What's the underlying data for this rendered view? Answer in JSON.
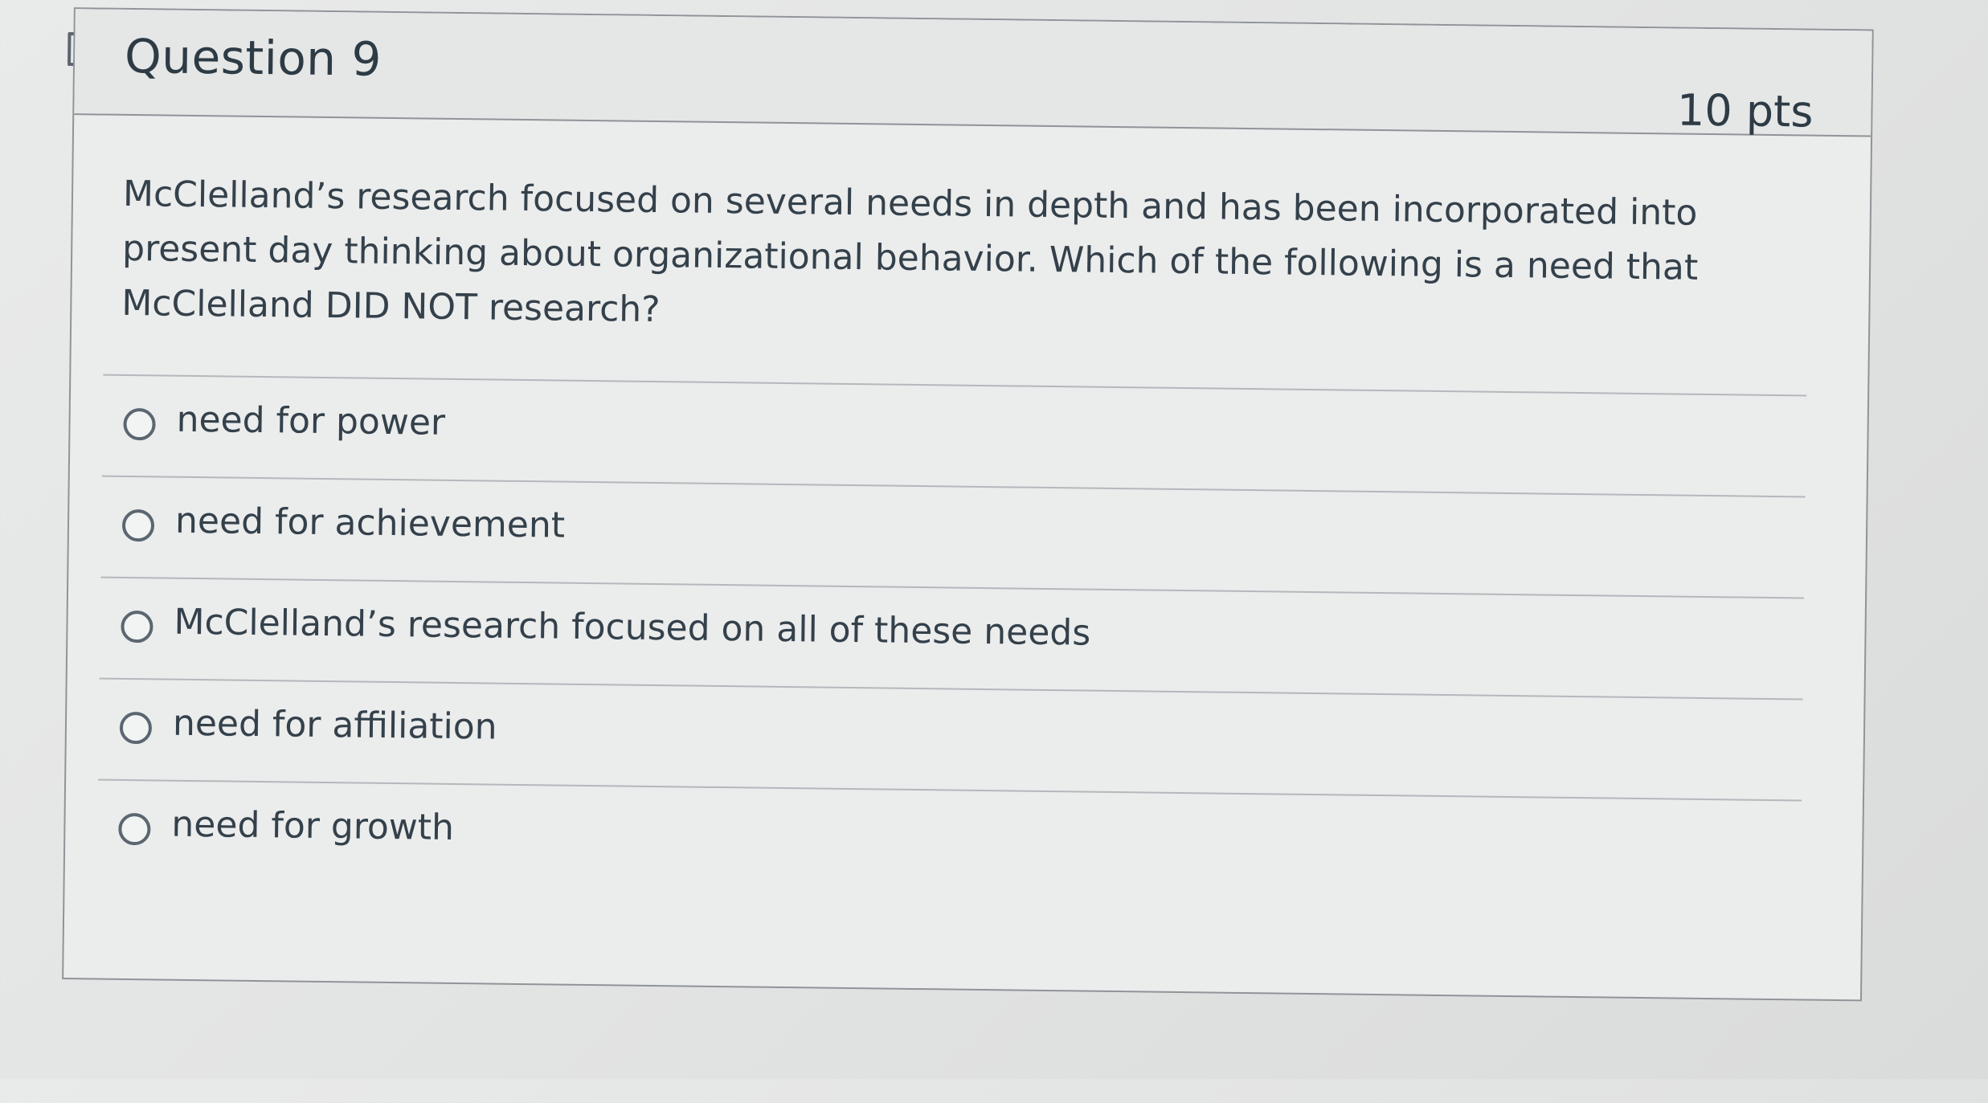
{
  "question": {
    "title": "Question 9",
    "points": "10 pts",
    "text": "McClelland’s research focused on several needs in depth and has been incorporated into present day thinking about organizational behavior. Which of the following is a need that McClelland DID NOT research?",
    "flag_icon": "bookmark-flag-icon"
  },
  "answers": [
    {
      "label": "need for power",
      "selected": false
    },
    {
      "label": "need for achievement",
      "selected": false
    },
    {
      "label": "McClelland’s research focused on all of these needs",
      "selected": false
    },
    {
      "label": "need for affiliation",
      "selected": false
    },
    {
      "label": "need for growth",
      "selected": false
    }
  ],
  "colors": {
    "text": "#2d3b45",
    "border": "#8f9499",
    "background": "#ebecec"
  }
}
